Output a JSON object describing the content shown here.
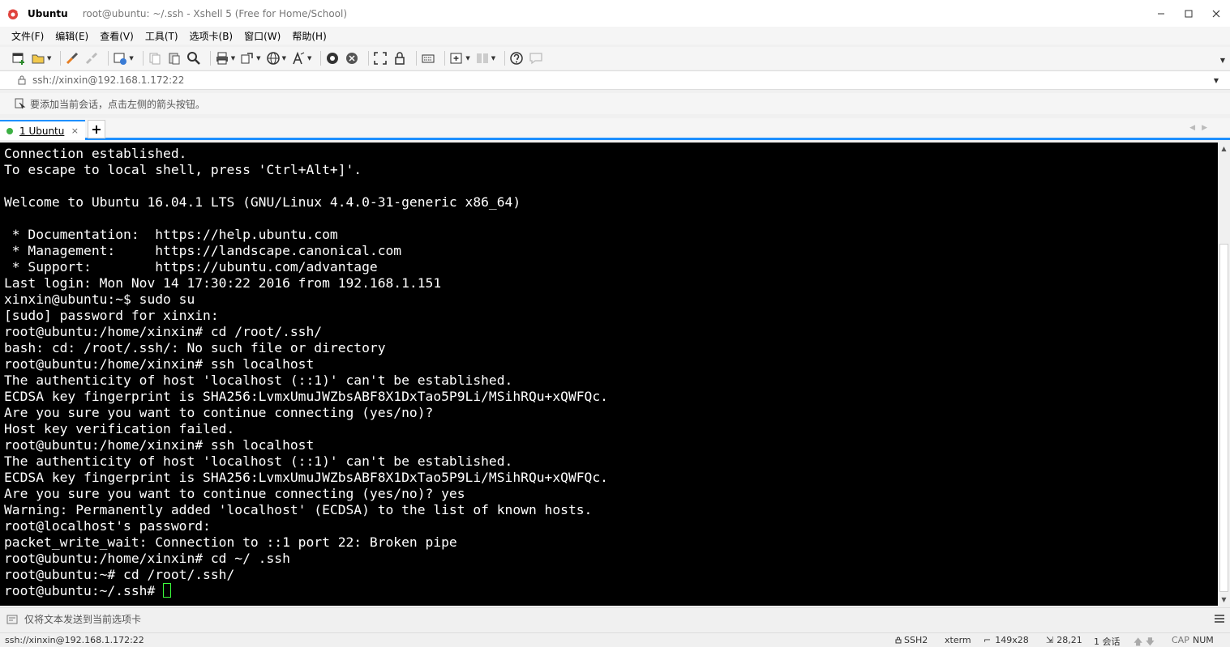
{
  "titlebar": {
    "app_name": "Ubuntu",
    "title": "root@ubuntu: ~/.ssh - Xshell 5 (Free for Home/School)"
  },
  "menu": [
    "文件(F)",
    "编辑(E)",
    "查看(V)",
    "工具(T)",
    "选项卡(B)",
    "窗口(W)",
    "帮助(H)"
  ],
  "address": {
    "value": "ssh://xinxin@192.168.1.172:22"
  },
  "hint": {
    "text": "要添加当前会话，点击左侧的箭头按钮。"
  },
  "tabs": [
    {
      "label": "1 Ubuntu",
      "active": true,
      "status_color": "#3cb043"
    }
  ],
  "terminal": {
    "lines": [
      "Connection established.",
      "To escape to local shell, press 'Ctrl+Alt+]'.",
      "",
      "Welcome to Ubuntu 16.04.1 LTS (GNU/Linux 4.4.0-31-generic x86_64)",
      "",
      " * Documentation:  https://help.ubuntu.com",
      " * Management:     https://landscape.canonical.com",
      " * Support:        https://ubuntu.com/advantage",
      "Last login: Mon Nov 14 17:30:22 2016 from 192.168.1.151",
      "xinxin@ubuntu:~$ sudo su",
      "[sudo] password for xinxin:",
      "root@ubuntu:/home/xinxin# cd /root/.ssh/",
      "bash: cd: /root/.ssh/: No such file or directory",
      "root@ubuntu:/home/xinxin# ssh localhost",
      "The authenticity of host 'localhost (::1)' can't be established.",
      "ECDSA key fingerprint is SHA256:LvmxUmuJWZbsABF8X1DxTao5P9Li/MSihRQu+xQWFQc.",
      "Are you sure you want to continue connecting (yes/no)?",
      "Host key verification failed.",
      "root@ubuntu:/home/xinxin# ssh localhost",
      "The authenticity of host 'localhost (::1)' can't be established.",
      "ECDSA key fingerprint is SHA256:LvmxUmuJWZbsABF8X1DxTao5P9Li/MSihRQu+xQWFQc.",
      "Are you sure you want to continue connecting (yes/no)? yes",
      "Warning: Permanently added 'localhost' (ECDSA) to the list of known hosts.",
      "root@localhost's password:",
      "packet_write_wait: Connection to ::1 port 22: Broken pipe",
      "root@ubuntu:/home/xinxin# cd ~/ .ssh",
      "root@ubuntu:~# cd /root/.ssh/",
      "root@ubuntu:~/.ssh# "
    ],
    "cursor_color": "#3cff3c"
  },
  "compose": {
    "text": "仅将文本发送到当前选项卡"
  },
  "status": {
    "connection": "ssh://xinxin@192.168.1.172:22",
    "protocol": "SSH2",
    "term": "xterm",
    "size": "149x28",
    "cursor_pos": "28,21",
    "sessions": "1 会话",
    "cap": "CAP",
    "num": "NUM"
  },
  "colors": {
    "accent": "#1e90ff",
    "terminal_bg": "#000000",
    "terminal_fg": "#ffffff"
  }
}
